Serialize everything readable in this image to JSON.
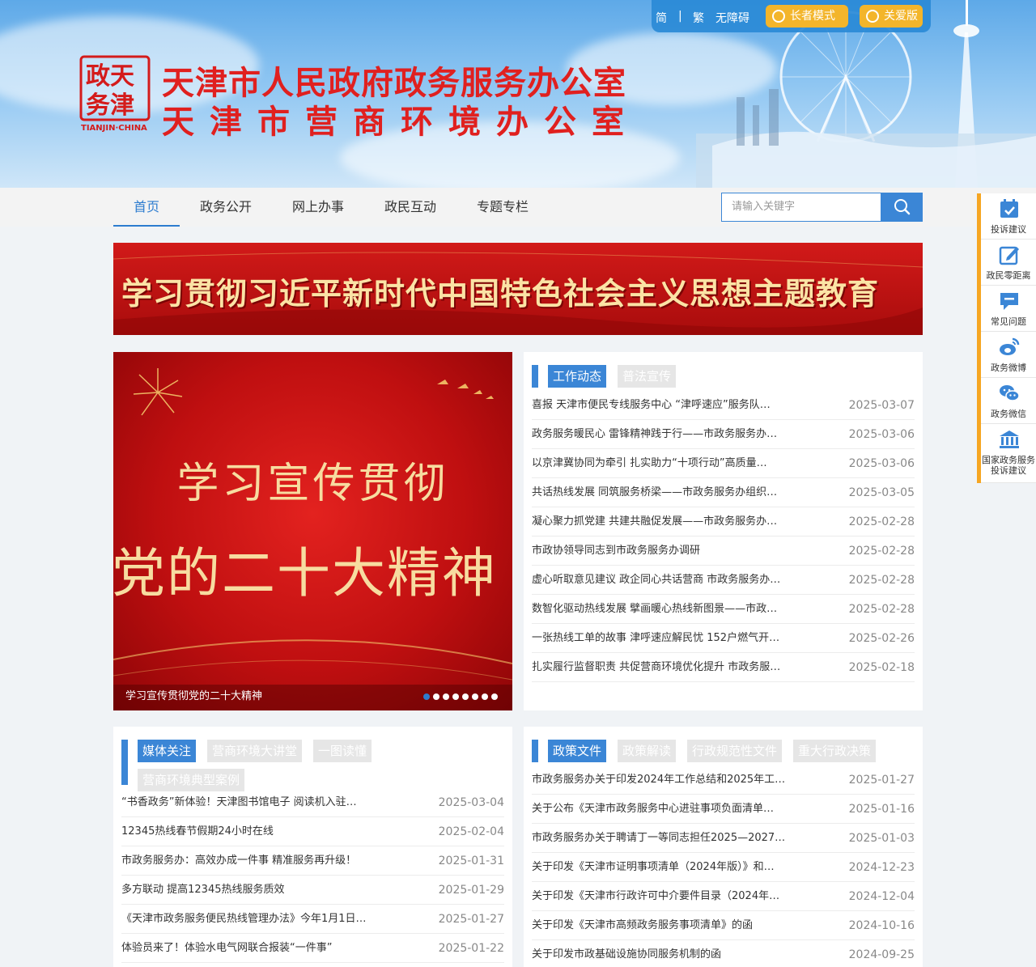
{
  "toolbar": {
    "simplified": "简",
    "sep": "|",
    "traditional": "繁",
    "accessible": "无障碍",
    "elder_mode": "长者模式",
    "care_edition": "关爱版"
  },
  "header": {
    "seal_text": "TIANJIN·CHINA",
    "title_line1": "天津市人民政府政务服务办公室",
    "title_line2": "天津市营商环境办公室"
  },
  "nav": {
    "items": [
      "首页",
      "政务公开",
      "网上办事",
      "政民互动",
      "专题专栏"
    ],
    "active": "首页"
  },
  "search": {
    "placeholder": "请输入关键字"
  },
  "promo_banner": {
    "text": "学习贯彻习近平新时代中国特色社会主义思想主题教育"
  },
  "carousel": {
    "line1": "学习宣传贯彻",
    "line2": "党的二十大精神",
    "caption": "学习宣传贯彻党的二十大精神",
    "dot_count": 8,
    "active_index": 0
  },
  "work_panel": {
    "tabs": [
      "工作动态",
      "普法宣传"
    ],
    "items": [
      {
        "title": "喜报 天津市便民专线服务中心 “津呼速应”服务队…",
        "date": "2025-03-07"
      },
      {
        "title": "政务服务暖民心 雷锋精神践于行——市政务服务办…",
        "date": "2025-03-06"
      },
      {
        "title": "以京津冀协同为牵引 扎实助力“十项行动”高质量…",
        "date": "2025-03-06"
      },
      {
        "title": "共话热线发展 同筑服务桥梁——市政务服务办组织…",
        "date": "2025-03-05"
      },
      {
        "title": "凝心聚力抓党建 共建共融促发展——市政务服务办…",
        "date": "2025-02-28"
      },
      {
        "title": "市政协领导同志到市政务服务办调研",
        "date": "2025-02-28"
      },
      {
        "title": "虚心听取意见建议 政企同心共话营商 市政务服务办…",
        "date": "2025-02-28"
      },
      {
        "title": "数智化驱动热线发展 擘画暖心热线新图景——市政…",
        "date": "2025-02-28"
      },
      {
        "title": "一张热线工单的故事 津呼速应解民忧 152户燃气开…",
        "date": "2025-02-26"
      },
      {
        "title": "扎实履行监督职责 共促营商环境优化提升 市政务服…",
        "date": "2025-02-18"
      }
    ]
  },
  "media_panel": {
    "tabs": [
      "媒体关注",
      "营商环境大讲堂",
      "一图读懂",
      "营商环境典型案例"
    ],
    "items": [
      {
        "title": "“书香政务”新体验！天津图书馆电子 阅读机入驻…",
        "date": "2025-03-04"
      },
      {
        "title": "12345热线春节假期24小时在线",
        "date": "2025-02-04"
      },
      {
        "title": "市政务服务办：高效办成一件事 精准服务再升级！",
        "date": "2025-01-31"
      },
      {
        "title": "多方联动 提高12345热线服务质效",
        "date": "2025-01-29"
      },
      {
        "title": "《天津市政务服务便民热线管理办法》今年1月1日…",
        "date": "2025-01-27"
      },
      {
        "title": "体验员来了！体验水电气网联合报装“一件事”",
        "date": "2025-01-22"
      }
    ]
  },
  "policy_panel": {
    "tabs": [
      "政策文件",
      "政策解读",
      "行政规范性文件",
      "重大行政决策"
    ],
    "items": [
      {
        "title": "市政务服务办关于印发2024年工作总结和2025年工…",
        "date": "2025-01-27"
      },
      {
        "title": "关于公布《天津市政务服务中心进驻事项负面清单…",
        "date": "2025-01-16"
      },
      {
        "title": "市政务服务办关于聘请丁一等同志担任2025—2027…",
        "date": "2025-01-03"
      },
      {
        "title": "关于印发《天津市证明事项清单（2024年版）》和…",
        "date": "2024-12-23"
      },
      {
        "title": "关于印发《天津市行政许可中介要件目录（2024年…",
        "date": "2024-12-04"
      },
      {
        "title": "关于印发《天津市高频政务服务事项清单》的函",
        "date": "2024-10-16"
      },
      {
        "title": "关于印发市政基础设施协同服务机制的函",
        "date": "2024-09-25"
      }
    ]
  },
  "float_bar": {
    "items": [
      {
        "label": "投诉建议",
        "icon": "calendar-check-icon"
      },
      {
        "label": "政民零距离",
        "icon": "edit-icon"
      },
      {
        "label": "常见问题",
        "icon": "chat-bubble-icon"
      },
      {
        "label": "政务微博",
        "icon": "weibo-icon"
      },
      {
        "label": "政务微信",
        "icon": "wechat-icon"
      },
      {
        "label": "国家政务服务投诉建议",
        "icon": "government-building-icon"
      }
    ]
  },
  "colors": {
    "accent": "#3b86d6",
    "title_red": "#e0201f",
    "float_orange": "#f6a623",
    "toolbar_blue": "#2a8ad6",
    "toolbar_button": "#f3b52b"
  }
}
